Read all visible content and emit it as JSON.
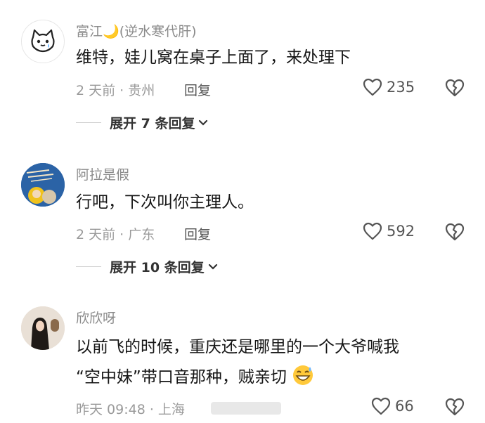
{
  "comments": [
    {
      "username": "富江",
      "username_suffix": "(逆水寒代肝)",
      "text": "维特，娃儿窝在桌子上面了，来处理下",
      "meta": "2 天前 · 贵州",
      "reply_label": "回复",
      "likes": "235",
      "expand_label": "展开 7 条回复"
    },
    {
      "username": "阿拉是假",
      "text": "行吧，下次叫你主理人。",
      "meta": "2 天前 · 广东",
      "reply_label": "回复",
      "likes": "592",
      "expand_label": "展开 10 条回复"
    },
    {
      "username": "欣欣呀",
      "text_line1": "以前飞的时候，重庆还是哪里的一个大爷喊我",
      "text_line2": "“空中妹”带口音那种，贼亲切",
      "meta": "昨天 09:48 · 上海",
      "likes": "66"
    }
  ],
  "icons": {
    "like": "heart-outline-icon",
    "dislike": "broken-heart-icon",
    "expand": "chevron-down-icon",
    "moon": "crescent-moon-icon",
    "emoji": "grinning-sweat-emoji-icon"
  }
}
